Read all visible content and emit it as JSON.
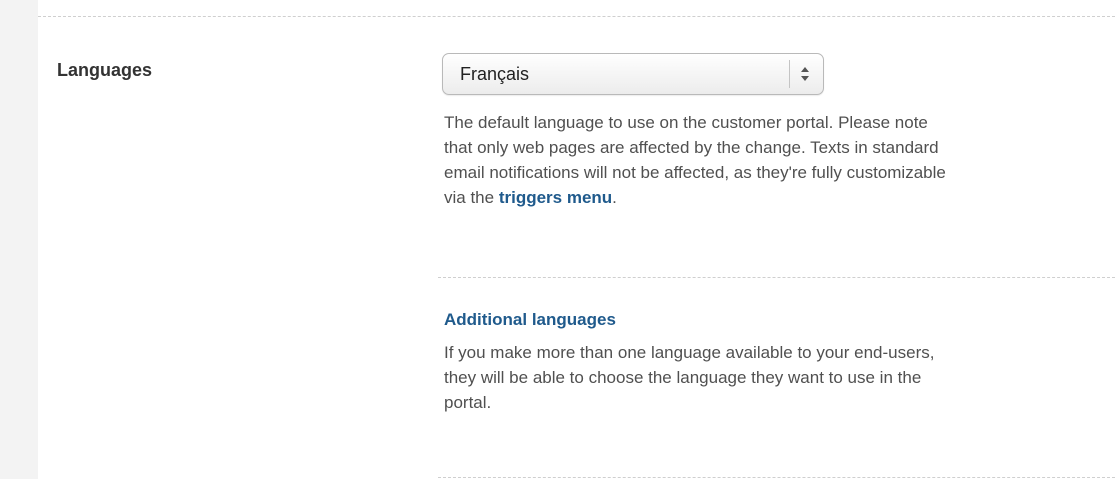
{
  "section": {
    "label": "Languages"
  },
  "language_select": {
    "value": "Français"
  },
  "default_description": {
    "line1": "The default language to use on the customer portal. Please note",
    "line2": "that only web pages are affected by the change. Texts in standard",
    "line3": "email notifications will not be affected, as they're fully customizable",
    "line4_prefix": "via the ",
    "line4_link": "triggers menu",
    "line4_suffix": "."
  },
  "additional": {
    "heading": "Additional languages",
    "line1": "If you make more than one language available to your end-users,",
    "line2": "they will be able to choose the language they want to use in the",
    "line3": "portal."
  },
  "colors": {
    "link": "#1f5a8c",
    "label": "#333333",
    "body_text": "#505050"
  },
  "icons": {
    "select_arrows": "up-down-arrows-icon"
  }
}
